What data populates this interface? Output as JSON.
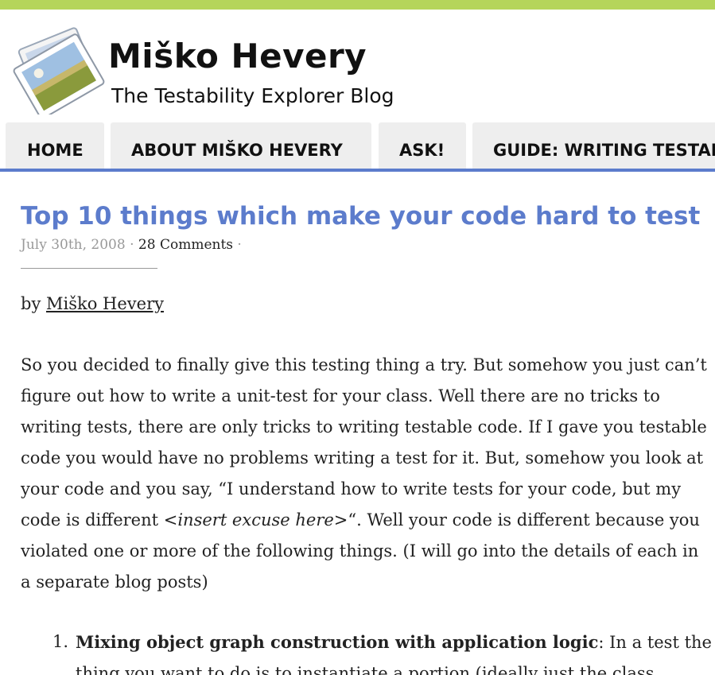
{
  "header": {
    "site_title": "Miško Hevery",
    "tagline": "The Testability Explorer Blog",
    "accent_bar_color": "#b5d55a"
  },
  "nav": {
    "accent_color": "#5c7ccc",
    "tabs": [
      {
        "label": "HOME"
      },
      {
        "label": "ABOUT MIŠKO HEVERY"
      },
      {
        "label": "ASK!"
      },
      {
        "label": "GUIDE: WRITING TESTABLE CODE"
      }
    ]
  },
  "post": {
    "title": "Top 10 things which make your code hard to test",
    "title_color": "#5c7ccc",
    "date": "July 30th, 2008",
    "separator": "·",
    "comments": "28 Comments",
    "byline_prefix": "by",
    "author": "Miško Hevery",
    "paragraph_part1": "So you decided to finally give this testing thing a try. But somehow you just can’t figure out how to write a unit-test for your class. Well there are no tricks to writing tests, there are only tricks to writing testable code. If I gave you testable code you would have no problems writing a test for it. But, somehow you look at your code and you say, “I understand how to write tests for your code, but my code is different ",
    "paragraph_italic": "<insert excuse here>",
    "paragraph_part2": "“. Well your code is different because you violated one or more of the following things. (I will go into the details of each in a separate blog posts)",
    "list": [
      {
        "number": "1.",
        "heading": "Mixing object graph construction with application logic",
        "text": ": In a test the thing you want to do is to instantiate a portion (ideally just the class"
      }
    ]
  }
}
